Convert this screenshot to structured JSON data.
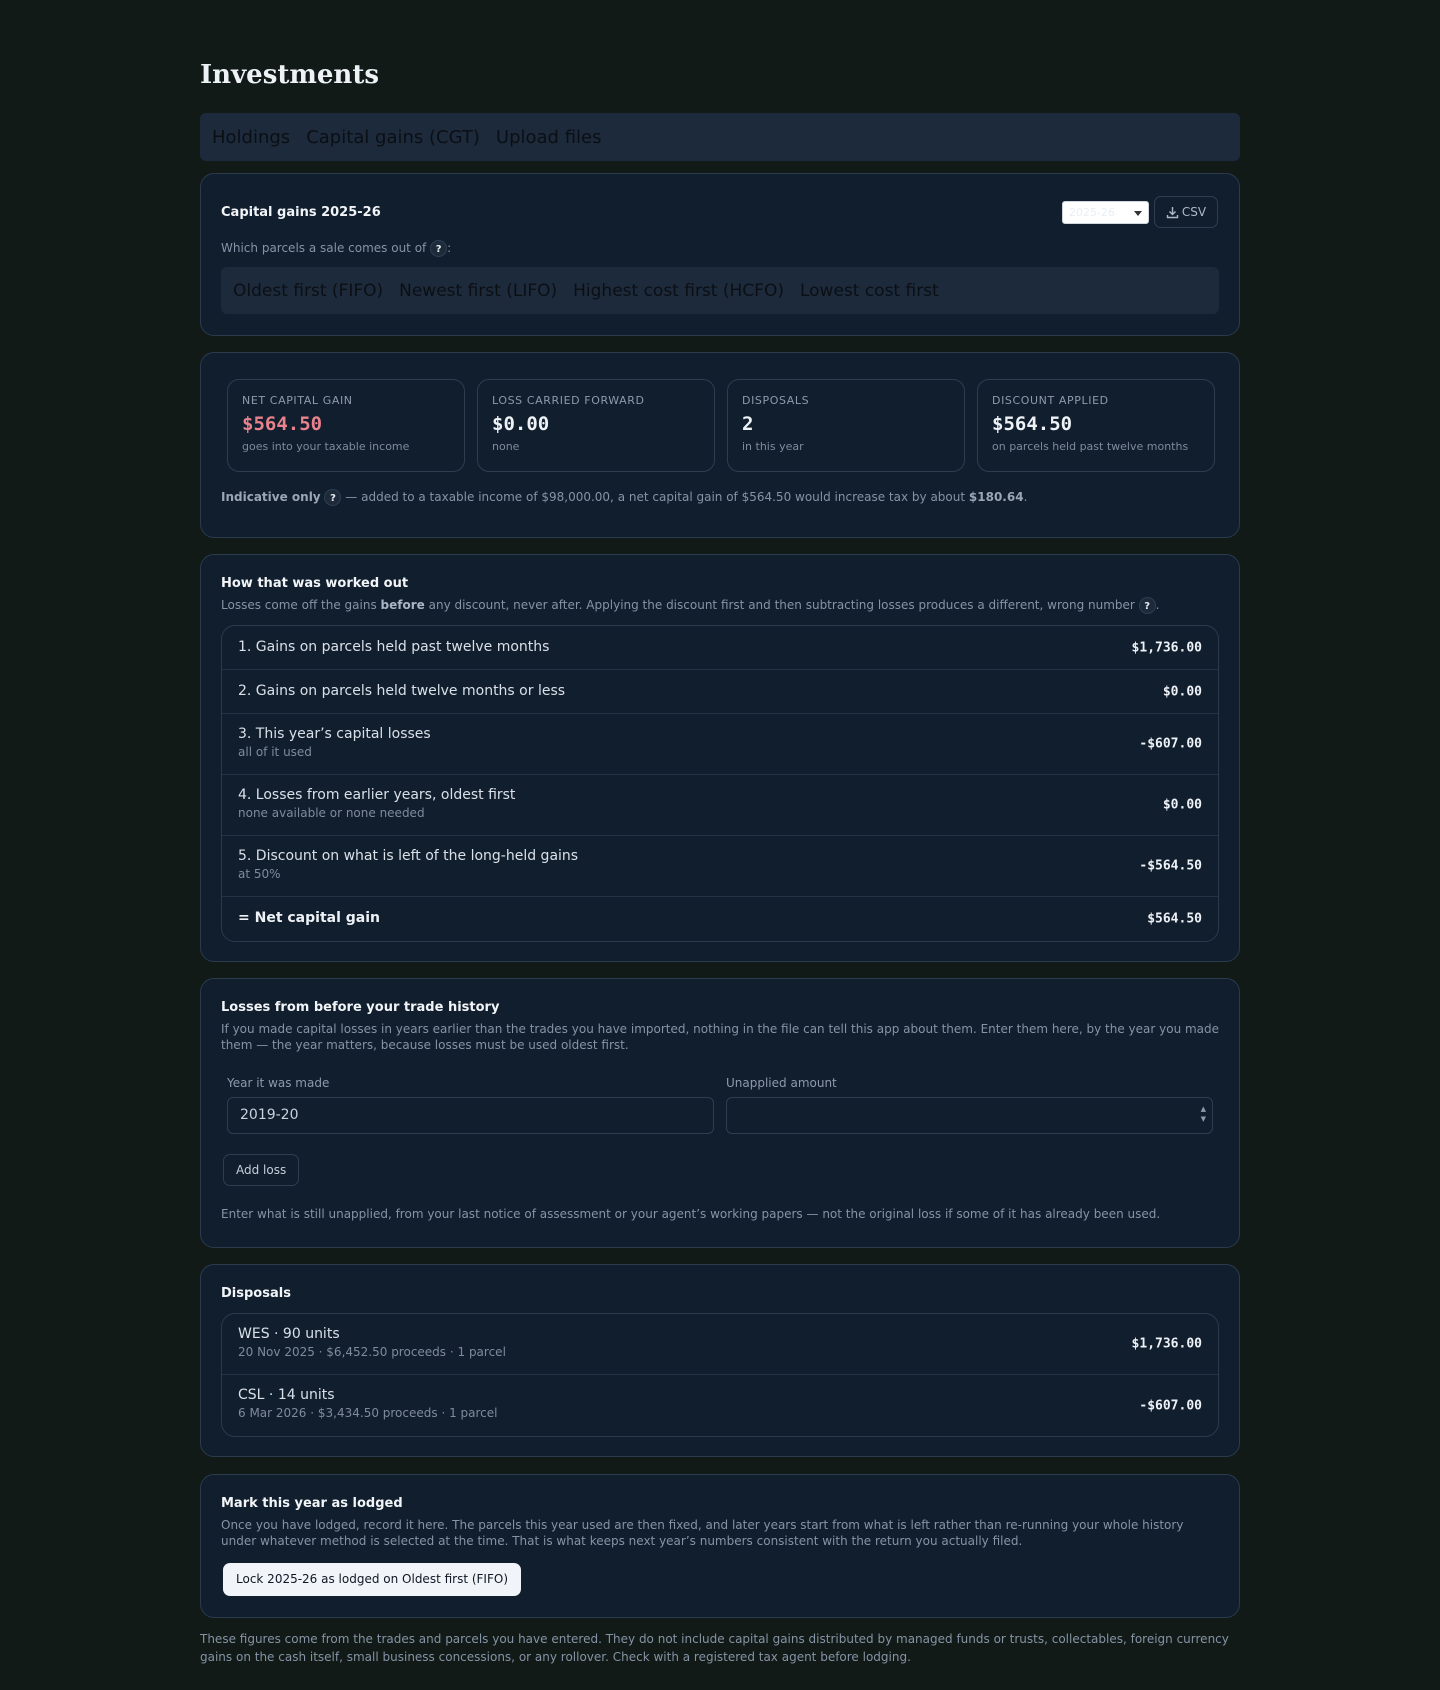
{
  "page": {
    "title": "Investments"
  },
  "tabs": [
    "Holdings",
    "Capital gains (CGT)",
    "Upload files"
  ],
  "summary_card": {
    "title": "Capital gains 2025-26",
    "year_select": "2025-26",
    "csv_label": "CSV",
    "method_prompt": "Which parcels a sale comes out of",
    "methods": [
      "Oldest first (FIFO)",
      "Newest first (LIFO)",
      "Highest cost first (HCFO)",
      "Lowest cost first"
    ]
  },
  "stats": [
    {
      "label": "NET CAPITAL GAIN",
      "value": "$564.50",
      "sub": "goes into your taxable income"
    },
    {
      "label": "LOSS CARRIED FORWARD",
      "value": "$0.00",
      "sub": "none"
    },
    {
      "label": "DISPOSALS",
      "value": "2",
      "sub": "in this year"
    },
    {
      "label": "DISCOUNT APPLIED",
      "value": "$564.50",
      "sub": "on parcels held past twelve months"
    }
  ],
  "indicative": {
    "lead": "Indicative only",
    "text": "— added to a taxable income of $98,000.00, a net capital gain of $564.50 would increase tax by about",
    "amount": "$180.64"
  },
  "workings": {
    "title": "How that was worked out",
    "note_a": "Losses come off the gains",
    "note_bold": "before",
    "note_b": "any discount, never after. Applying the discount first and then subtracting losses produces a different, wrong number",
    "rows": [
      {
        "label": "1. Gains on parcels held past twelve months",
        "sub": "",
        "amount": "$1,736.00"
      },
      {
        "label": "2. Gains on parcels held twelve months or less",
        "sub": "",
        "amount": "$0.00"
      },
      {
        "label": "3. This year’s capital losses",
        "sub": "all of it used",
        "amount": "-$607.00"
      },
      {
        "label": "4. Losses from earlier years, oldest first",
        "sub": "none available or none needed",
        "amount": "$0.00"
      },
      {
        "label": "5. Discount on what is left of the long-held gains",
        "sub": "at 50%",
        "amount": "-$564.50"
      }
    ],
    "total": {
      "label": "= Net capital gain",
      "amount": "$564.50"
    }
  },
  "prior_losses": {
    "title": "Losses from before your trade history",
    "desc": "If you made capital losses in years earlier than the trades you have imported, nothing in the file can tell this app about them. Enter them here, by the year you made them — the year matters, because losses must be used oldest first.",
    "year_label": "Year it was made",
    "year_value": "2019-20",
    "amount_label": "Unapplied amount",
    "amount_value": "",
    "add_label": "Add loss",
    "hint": "Enter what is still unapplied, from your last notice of assessment or your agent’s working papers — not the original loss if some of it has already been used."
  },
  "disposals": {
    "title": "Disposals",
    "items": [
      {
        "title": "WES · 90 units",
        "sub": "20 Nov 2025 · $6,452.50 proceeds · 1 parcel",
        "amount": "$1,736.00"
      },
      {
        "title": "CSL · 14 units",
        "sub": "6 Mar 2026 · $3,434.50 proceeds · 1 parcel",
        "amount": "-$607.00"
      }
    ]
  },
  "lodge": {
    "title": "Mark this year as lodged",
    "desc": "Once you have lodged, record it here. The parcels this year used are then fixed, and later years start from what is left rather than re-running your whole history under whatever method is selected at the time. That is what keeps next year’s numbers consistent with the return you actually filed.",
    "button": "Lock 2025-26 as lodged on Oldest first (FIFO)"
  },
  "footer": "These figures come from the trades and parcels you have entered. They do not include capital gains distributed by managed funds or trusts, collectables, foreign currency gains on the cash itself, small business concessions, or any rollover. Check with a registered tax agent before lodging.",
  "colors": {
    "background": "#111a16",
    "card": "#111e2e",
    "negative_accent": "#e8828c"
  }
}
